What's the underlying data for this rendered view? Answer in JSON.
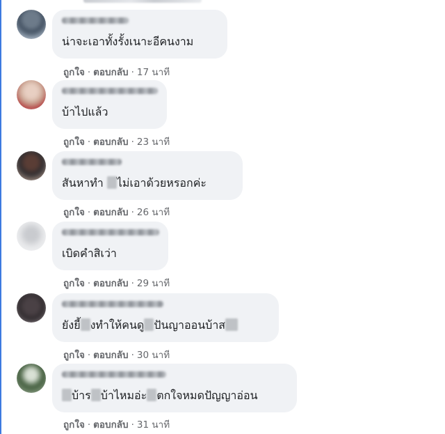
{
  "actions": {
    "like": "ถูกใจ",
    "reply": "ตอบกลับ",
    "separator": "·"
  },
  "comments": [
    {
      "text_parts": [
        "น่าจะเอาทั้งรั้งเนาะอีคนงาม"
      ],
      "time": "17 นาที"
    },
    {
      "text_parts": [
        "บ้าไปแล้ว"
      ],
      "time": "23 นาที"
    },
    {
      "text_parts": [
        "สันหาทำ ",
        "ไม่เอาด้วยหรอกค่ะ"
      ],
      "time": "26 นาที"
    },
    {
      "text_parts": [
        "เบิดคำสิเว่า"
      ],
      "time": "29 นาที"
    },
    {
      "text_parts": [
        "ยังยี้",
        "งทำให้คนดู",
        "ปันญาออนบ้าส"
      ],
      "time": "30 นาที"
    },
    {
      "text_parts": [
        "",
        "บ้าร",
        "บ้าไหมอ่ะ",
        "ตกใจหมดปัญญาอ่อน"
      ],
      "time": "31 นาที"
    }
  ]
}
